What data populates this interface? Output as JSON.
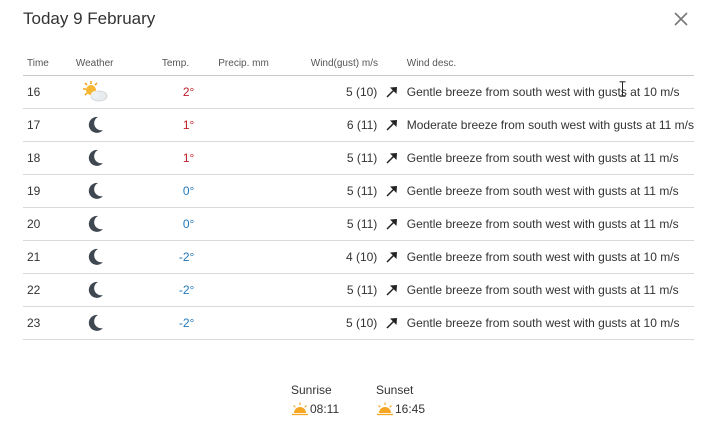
{
  "header": {
    "title": "Today 9 February",
    "close_icon": "close-icon"
  },
  "table": {
    "columns": {
      "time": "Time",
      "weather": "Weather",
      "temp": "Temp.",
      "precip": "Precip. mm",
      "wind": "Wind(gust) m/s",
      "desc": "Wind desc."
    },
    "rows": [
      {
        "time": "16",
        "weather": "partly-cloudy-sun-icon",
        "temp": "2°",
        "temp_class": "pos",
        "precip": "",
        "wind": "5 (10)",
        "wind_dir": "north-east-arrow-icon",
        "desc": "Gentle breeze from south west with gusts at 10 m/s"
      },
      {
        "time": "17",
        "weather": "moon-icon",
        "temp": "1°",
        "temp_class": "pos",
        "precip": "",
        "wind": "6 (11)",
        "wind_dir": "north-east-arrow-icon",
        "desc": "Moderate breeze from south west with gusts at 11 m/s"
      },
      {
        "time": "18",
        "weather": "moon-icon",
        "temp": "1°",
        "temp_class": "pos",
        "precip": "",
        "wind": "5 (11)",
        "wind_dir": "north-east-arrow-icon",
        "desc": "Gentle breeze from south west with gusts at 11 m/s"
      },
      {
        "time": "19",
        "weather": "moon-icon",
        "temp": "0°",
        "temp_class": "zero",
        "precip": "",
        "wind": "5 (11)",
        "wind_dir": "north-east-arrow-icon",
        "desc": "Gentle breeze from south west with gusts at 11 m/s"
      },
      {
        "time": "20",
        "weather": "moon-icon",
        "temp": "0°",
        "temp_class": "zero",
        "precip": "",
        "wind": "5 (11)",
        "wind_dir": "north-east-arrow-icon",
        "desc": "Gentle breeze from south west with gusts at 11 m/s"
      },
      {
        "time": "21",
        "weather": "moon-icon",
        "temp": "-2°",
        "temp_class": "neg",
        "precip": "",
        "wind": "4 (10)",
        "wind_dir": "north-east-arrow-icon",
        "desc": "Gentle breeze from south west with gusts at 10 m/s"
      },
      {
        "time": "22",
        "weather": "moon-icon",
        "temp": "-2°",
        "temp_class": "neg",
        "precip": "",
        "wind": "5 (11)",
        "wind_dir": "north-east-arrow-icon",
        "desc": "Gentle breeze from south west with gusts at 11 m/s"
      },
      {
        "time": "23",
        "weather": "moon-icon",
        "temp": "-2°",
        "temp_class": "neg",
        "precip": "",
        "wind": "5 (10)",
        "wind_dir": "north-east-arrow-icon",
        "desc": "Gentle breeze from south west with gusts at 10 m/s"
      }
    ]
  },
  "sun": {
    "sunrise_label": "Sunrise",
    "sunrise_time": "08:11",
    "sunset_label": "Sunset",
    "sunset_time": "16:45",
    "sunrise_icon": "sunrise-icon",
    "sunset_icon": "sunset-icon"
  },
  "colors": {
    "temp_positive": "#c0202a",
    "temp_cold": "#2478b8",
    "sun_icon": "#f5a623"
  }
}
